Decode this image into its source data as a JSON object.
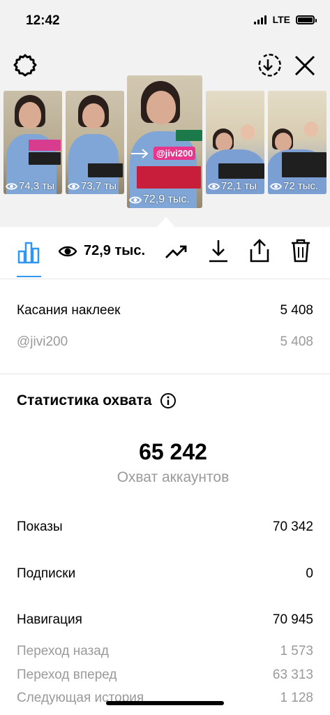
{
  "status_bar": {
    "time": "12:42",
    "network": "LTE"
  },
  "stories": [
    {
      "views": "74,3 ты"
    },
    {
      "views": "73,7 ты"
    },
    {
      "views": "72,9 тыс.",
      "sticker": "@jivi200",
      "selected": true
    },
    {
      "views": "72,1 ты"
    },
    {
      "views": "72 тыс."
    }
  ],
  "toolbar": {
    "views_count": "72,9 тыс.",
    "accent": "#2f97f0"
  },
  "sticker_taps": {
    "label": "Касания наклеек",
    "value": "5 408",
    "sub": {
      "label": "@jivi200",
      "value": "5 408"
    }
  },
  "reach": {
    "title": "Статистика охвата",
    "big_number": "65 242",
    "big_label": "Охват аккаунтов",
    "rows": [
      {
        "label": "Показы",
        "value": "70 342"
      },
      {
        "label": "Подписки",
        "value": "0"
      },
      {
        "label": "Навигация",
        "value": "70 945"
      }
    ],
    "nav_rows": [
      {
        "label": "Переход назад",
        "value": "1 573"
      },
      {
        "label": "Переход вперед",
        "value": "63 313"
      },
      {
        "label": "Следующая история",
        "value": "1 128"
      }
    ]
  },
  "icons": {
    "settings": "gear-icon",
    "download_circle": "download-circle-icon",
    "close": "close-icon",
    "stats": "bar-chart-icon",
    "eye": "eye-icon",
    "trend": "trend-up-icon",
    "download": "download-icon",
    "share": "share-icon",
    "delete": "trash-icon",
    "info": "info-icon"
  }
}
